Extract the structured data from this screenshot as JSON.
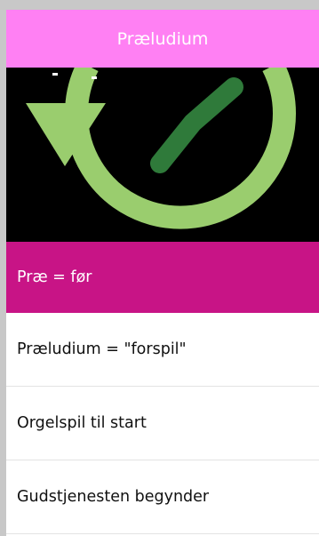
{
  "header": {
    "title": "Præludium"
  },
  "hero": {
    "icon": "clock-refresh-icon",
    "colors": {
      "background": "#000000",
      "arrow_light": "#9acd6e",
      "hand_dark": "#2f7a3a"
    }
  },
  "list": {
    "items": [
      {
        "label": "Præ = før",
        "active": true
      },
      {
        "label": "Præludium = \"forspil\"",
        "active": false
      },
      {
        "label": "Orgelspil til start",
        "active": false
      },
      {
        "label": "Gudstjenesten begynder",
        "active": false
      }
    ]
  },
  "colors": {
    "header_bg": "#ff80f3",
    "active_bg": "#c81486",
    "frame_bg": "#c8c8c8"
  }
}
